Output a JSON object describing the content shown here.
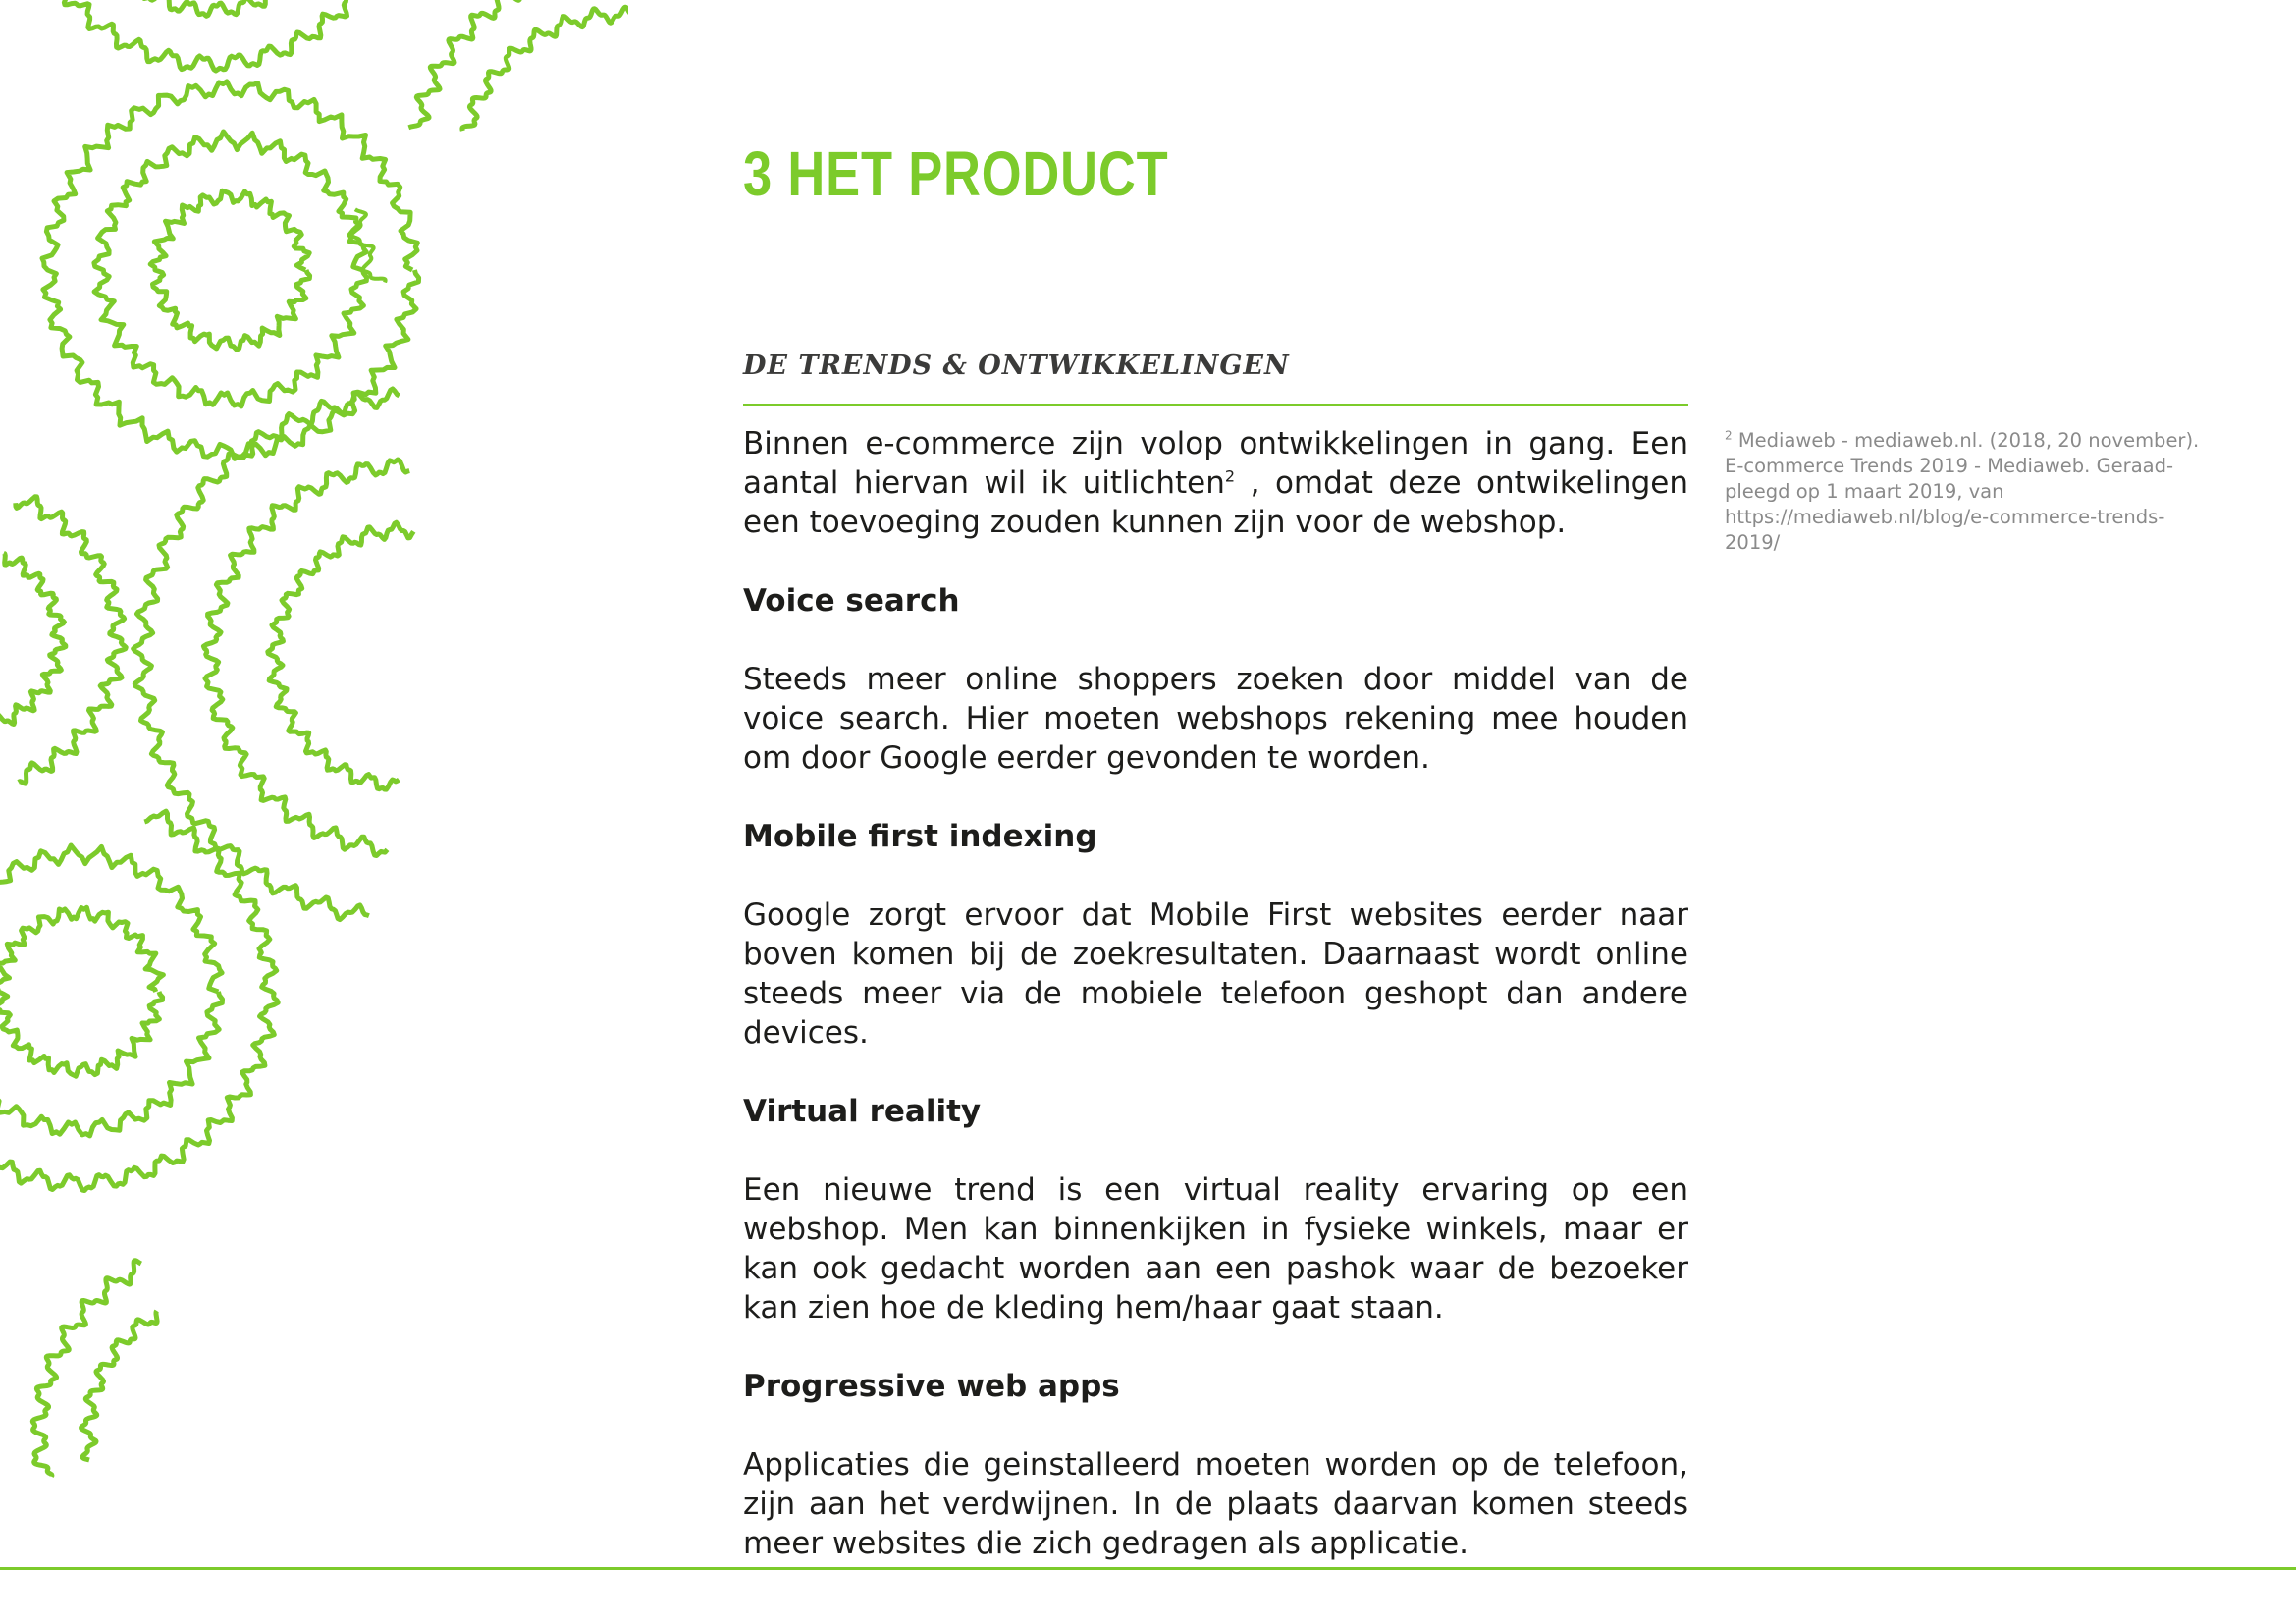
{
  "page": {
    "accent_color": "#7ccb2b",
    "text_color": "#1d1d1b",
    "footnote_color": "#8a8a8a",
    "decoration": "green scribbled concentric circle patterns along the left edge"
  },
  "chapter": {
    "title": "3 HET PRODUCT"
  },
  "section": {
    "heading": "DE TRENDS & ONTWIKKELINGEN"
  },
  "intro": {
    "part1": "Binnen e-commerce zijn volop ontwikkelingen in gang. Een aantal hiervan wil ik uitlichten",
    "footnote_ref": "2",
    "part2": " , omdat deze ontwikelingen een toevoeging zouden kunnen zijn voor de webshop."
  },
  "trends": [
    {
      "title": "Voice search",
      "text": "Steeds meer online shoppers zoeken door middel van de voice search. Hier moeten webshops rekening mee houden om door Google eerder gevonden te worden."
    },
    {
      "title": "Mobile first indexing",
      "text": "Google zorgt ervoor dat Mobile First websites eerder naar boven komen bij de zoekresultaten. Daarnaast wordt online steeds meer via de mobiele telefoon geshopt dan andere devices."
    },
    {
      "title": "Virtual reality",
      "text": "Een nieuwe trend is een virtual reality ervaring op een webshop. Men kan binnenkijken in fysieke winkels, maar er kan ook gedacht worden aan een pashok waar de bezoeker kan zien hoe de kleding hem/haar gaat staan."
    },
    {
      "title": "Progressive web apps",
      "text": "Applicaties die geinstalleerd moeten worden op de telefoon, zijn aan het verdwijnen. In de plaats daarvan komen steeds meer websites die zich gedragen als applicatie."
    }
  ],
  "footnote": {
    "number": "2",
    "text": " Mediaweb - mediaweb.nl. (2018, 20 november). E-commerce Trends 2019 - Mediaweb. Geraad-pleegd op 1 maart 2019, van https://mediaweb.nl/blog/e-commerce-trends-2019/"
  }
}
